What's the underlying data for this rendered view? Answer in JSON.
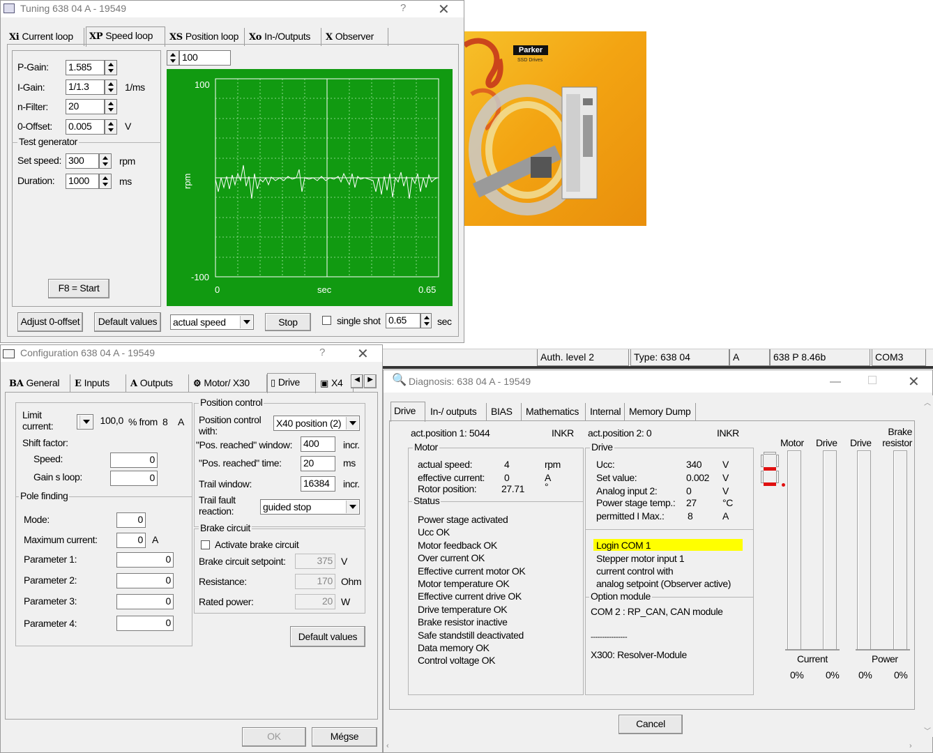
{
  "tuning": {
    "title": "Tuning  638 04 A - 19549",
    "help": "?",
    "close": "✕",
    "tabs": [
      "Current loop",
      "Speed loop",
      "Position loop",
      "In-/Outputs",
      "Observer"
    ],
    "tab_icons": [
      "Xi",
      "XP",
      "XS",
      "Xo",
      "X"
    ],
    "params": {
      "p_gain_label": "P-Gain:",
      "p_gain": "1.585",
      "i_gain_label": "I-Gain:",
      "i_gain": "1/1.3",
      "i_gain_unit": "1/ms",
      "n_filter_label": "n-Filter:",
      "n_filter": "20",
      "offset_label": "0-Offset:",
      "offset": "0.005",
      "offset_unit": "V"
    },
    "test_generator": {
      "title": "Test generator",
      "set_speed_label": "Set speed:",
      "set_speed": "300",
      "set_speed_unit": "rpm",
      "duration_label": "Duration:",
      "duration": "1000",
      "duration_unit": "ms"
    },
    "start_button": "F8 = Start",
    "scale_value": "100",
    "scope": {
      "y_top": "100",
      "y_bottom": "-100",
      "y_label": "rpm",
      "x_left": "0",
      "x_mid": "sec",
      "x_right": "0.65"
    },
    "bottom": {
      "adjust_offset": "Adjust 0-offset",
      "default_values": "Default values",
      "signal_select": "actual speed",
      "stop": "Stop",
      "single_shot": "single shot",
      "time_value": "0.65",
      "time_unit": "sec"
    }
  },
  "logo": {
    "brand": "Parker",
    "sub": "SSD Drives"
  },
  "statusbar": {
    "auth": "Auth. level 2",
    "type": "Type: 638 04",
    "variant": "A",
    "firmware": "638 P 8.46b",
    "port": "COM3"
  },
  "config": {
    "title": "Configuration 638 04 A - 19549",
    "help": "?",
    "close": "✕",
    "tabs": [
      "General",
      "Inputs",
      "Outputs",
      "Motor/ X30",
      "Drive",
      "X4"
    ],
    "tab_icons": [
      "BA",
      "E",
      "A",
      "",
      "",
      ""
    ],
    "limit": {
      "label": "Limit current:",
      "value": "100,0",
      "from": "% from",
      "max": "8",
      "unit": "A"
    },
    "shift_factor": {
      "label": "Shift factor:",
      "speed_label": "Speed:",
      "speed": "0",
      "gain_label": "Gain s loop:",
      "gain": "0"
    },
    "pole_finding": {
      "title": "Pole finding",
      "mode_label": "Mode:",
      "mode": "0",
      "max_current_label": "Maximum current:",
      "max_current": "0",
      "max_current_unit": "A",
      "p1_label": "Parameter 1:",
      "p1": "0",
      "p2_label": "Parameter 2:",
      "p2": "0",
      "p3_label": "Parameter 3:",
      "p3": "0",
      "p4_label": "Parameter 4:",
      "p4": "0"
    },
    "position_control": {
      "title": "Position control",
      "with_label": "Position control with:",
      "with_value": "X40 position (2)",
      "window_label": "\"Pos. reached\" window:",
      "window": "400",
      "window_unit": "incr.",
      "time_label": "\"Pos. reached\" time:",
      "time": "20",
      "time_unit": "ms",
      "trail_label": "Trail window:",
      "trail": "16384",
      "trail_unit": "incr.",
      "fault_label": "Trail fault reaction:",
      "fault": "guided stop"
    },
    "brake_circuit": {
      "title": "Brake circuit",
      "activate_label": "Activate brake circuit",
      "setpoint_label": "Brake circuit setpoint:",
      "setpoint": "375",
      "setpoint_unit": "V",
      "resistance_label": "Resistance:",
      "resistance": "170",
      "resistance_unit": "Ohm",
      "power_label": "Rated power:",
      "power": "20",
      "power_unit": "W"
    },
    "default_values": "Default values",
    "ok": "OK",
    "cancel": "Mégse"
  },
  "diagnosis": {
    "title": "Diagnosis: 638 04 A - 19549",
    "tabs": [
      "Drive",
      "In-/ outputs",
      "BIAS",
      "Mathematics",
      "Internal",
      "Memory Dump"
    ],
    "act_pos1_label": "act.position 1: 5044",
    "act_pos1_unit": "INKR",
    "act_pos2_label": "act.position 2:  0",
    "act_pos2_unit": "INKR",
    "motor": {
      "title": "Motor",
      "rows": [
        {
          "label": "actual speed:",
          "value": "4",
          "unit": "rpm"
        },
        {
          "label": "effective current:",
          "value": "0",
          "unit": "A"
        },
        {
          "label": "Rotor position:",
          "value": "27.71",
          "unit": "°"
        }
      ]
    },
    "status": {
      "title": "Status",
      "items": [
        "Power stage activated",
        "Ucc OK",
        "Motor feedback OK",
        "Over current OK",
        "Effective current motor OK",
        "Motor temperature OK",
        "Effective current drive OK",
        "Drive temperature OK",
        "Brake resistor inactive",
        "Safe standstill deactivated",
        "Data memory OK",
        "Control voltage OK"
      ]
    },
    "drive": {
      "title": "Drive",
      "rows": [
        {
          "label": "Ucc:",
          "value": "340",
          "unit": "V"
        },
        {
          "label": "Set value:",
          "value": "0.002",
          "unit": "V"
        },
        {
          "label": "Analog input 2:",
          "value": "0",
          "unit": "V"
        },
        {
          "label": "Power stage temp.:",
          "value": "27",
          "unit": "°C"
        },
        {
          "label": "permitted I Max.:",
          "value": "8",
          "unit": "A"
        }
      ]
    },
    "messages": {
      "highlight": "Login COM 1",
      "lines": [
        "Stepper motor input 1",
        "current control with",
        "analog setpoint (Observer active)"
      ]
    },
    "option_module": {
      "title": "Option module",
      "com2": "COM 2 :  RP_CAN, CAN module",
      "separator": "----------------",
      "x300": "X300: Resolver-Module"
    },
    "bars": {
      "headers": [
        "Motor",
        "Drive",
        "Drive",
        "Brake resistor"
      ],
      "current_label": "Current",
      "power_label": "Power",
      "values": [
        "0%",
        "0%",
        "0%",
        "0%"
      ],
      "levels": [
        0,
        0,
        0,
        0
      ]
    },
    "cancel": "Cancel"
  },
  "colors": {
    "scope_bg": "#119a11",
    "highlight": "#ffff00",
    "seg_red": "#e01010"
  }
}
